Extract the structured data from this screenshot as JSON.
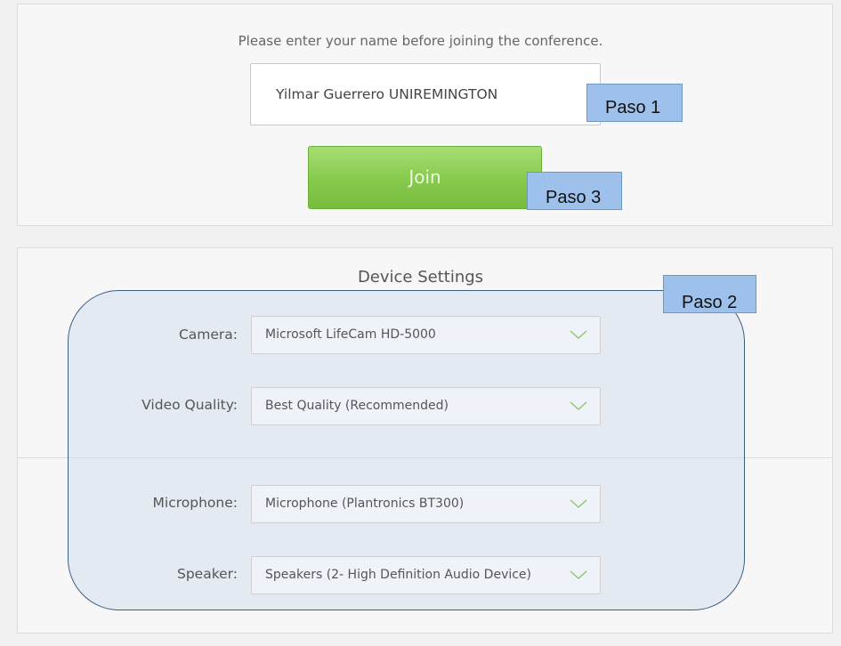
{
  "join_section": {
    "prompt": "Please enter your name before joining the conference.",
    "name_value": "Yilmar Guerrero UNIREMINGTON",
    "join_label": "Join"
  },
  "device_settings": {
    "title": "Device Settings",
    "fields": [
      {
        "label": "Camera:",
        "value": "Microsoft LifeCam HD-5000"
      },
      {
        "label": "Video Quality:",
        "value": "Best Quality (Recommended)"
      },
      {
        "label": "Microphone:",
        "value": "Microphone (Plantronics BT300)"
      },
      {
        "label": "Speaker:",
        "value": "Speakers (2- High Definition Audio Device)"
      }
    ]
  },
  "callouts": {
    "paso1": "Paso 1",
    "paso2": "Paso 2",
    "paso3": "Paso 3"
  },
  "icons": {
    "dropdown": "chevron-down-icon"
  },
  "colors": {
    "join_button": "#86c94c",
    "callout_fill": "#9dc1ea",
    "highlight_border": "#3c5f86"
  }
}
